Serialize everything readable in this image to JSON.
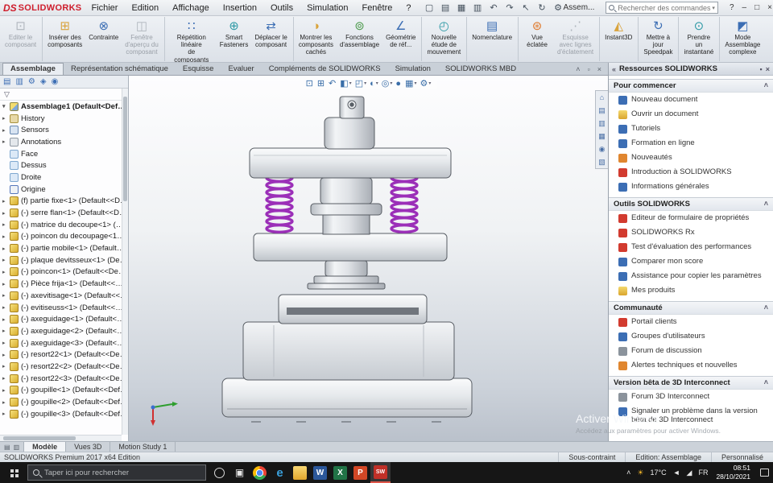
{
  "colors": {
    "logo_red": "#cf1e2c",
    "spring": "#9b2fb8",
    "accent_blue": "#3c6eb4"
  },
  "titlebar": {
    "logo_ds": "DS",
    "logo_text": "SOLIDWORKS",
    "menus": [
      "Fichier",
      "Edition",
      "Affichage",
      "Insertion",
      "Outils",
      "Simulation",
      "Fenêtre",
      "?"
    ],
    "qat": [
      {
        "g": "▢",
        "n": "new-document-icon"
      },
      {
        "g": "▤",
        "n": "open-document-icon"
      },
      {
        "g": "▦",
        "n": "save-icon"
      },
      {
        "g": "▥",
        "n": "print-icon"
      },
      {
        "g": "↶",
        "n": "undo-icon"
      },
      {
        "g": "↷",
        "n": "redo-icon"
      },
      {
        "g": "↖",
        "n": "select-icon"
      },
      {
        "g": "↻",
        "n": "rebuild-icon"
      },
      {
        "g": "⚙",
        "n": "options-icon"
      }
    ],
    "doc_name": "Assem...",
    "search_placeholder": "Rechercher des commandes",
    "search_drop": "▾",
    "win": [
      {
        "g": "?",
        "n": "help-button"
      },
      {
        "g": "–",
        "n": "minimize-button"
      },
      {
        "g": "□",
        "n": "maximize-button"
      },
      {
        "g": "×",
        "n": "close-button"
      }
    ]
  },
  "ribbon": {
    "buttons": [
      {
        "icon": "⊡",
        "ic": "ic-gr",
        "label": "Editer le\ncomposant",
        "cls": "disabled sep"
      },
      {
        "icon": "⊞",
        "ic": "ic-y",
        "label": "Insérer des\ncomposants"
      },
      {
        "icon": "⊗",
        "ic": "ic-b",
        "label": "Contrainte"
      },
      {
        "icon": "◫",
        "ic": "ic-gr",
        "label": "Fenêtre\nd'aperçu du\ncomposant",
        "cls": "disabled sep"
      },
      {
        "icon": "∷",
        "ic": "ic-b",
        "label": "Répétition linéaire\nde composants"
      },
      {
        "icon": "⊕",
        "ic": "ic-t",
        "label": "Smart\nFasteners"
      },
      {
        "icon": "⇄",
        "ic": "ic-b",
        "label": "Déplacer le\ncomposant",
        "cls": "sep"
      },
      {
        "icon": "◑",
        "ic": "ic-y",
        "label": "Montrer les\ncomposants\ncachés"
      },
      {
        "icon": "⊚",
        "ic": "ic-g",
        "label": "Fonctions\nd'assemblage"
      },
      {
        "icon": "∠",
        "ic": "ic-b",
        "label": "Géométrie\nde réf...",
        "cls": "sep"
      },
      {
        "icon": "◴",
        "ic": "ic-t",
        "label": "Nouvelle\nétude de\nmouvement",
        "cls": "sep"
      },
      {
        "icon": "▤",
        "ic": "ic-b",
        "label": "Nomenclature",
        "cls": "sep"
      },
      {
        "icon": "⊛",
        "ic": "ic-o",
        "label": "Vue\néclatée"
      },
      {
        "icon": "⋰",
        "ic": "ic-gr",
        "label": "Esquisse\navec lignes\nd'éclatement",
        "cls": "disabled sep"
      },
      {
        "icon": "◭",
        "ic": "ic-y",
        "label": "Instant3D",
        "cls": "sep"
      },
      {
        "icon": "↻",
        "ic": "ic-b",
        "label": "Mettre à\njour\nSpeedpak",
        "cls": "sep"
      },
      {
        "icon": "⊙",
        "ic": "ic-t",
        "label": "Prendre\nun\ninstantané",
        "cls": "sep"
      },
      {
        "icon": "◩",
        "ic": "ic-b",
        "label": "Mode\nAssemblage\ncomplexe"
      }
    ]
  },
  "tabs": {
    "items": [
      {
        "label": "Assemblage",
        "cls": "active"
      },
      {
        "label": "Représentation schématique"
      },
      {
        "label": "Esquisse"
      },
      {
        "label": "Evaluer"
      },
      {
        "label": "Compléments de SOLIDWORKS"
      },
      {
        "label": "Simulation"
      },
      {
        "label": "SOLIDWORKS MBD"
      }
    ],
    "right": [
      {
        "g": "˄",
        "n": "collapse-ribbon-icon"
      },
      {
        "g": "▫",
        "n": "restore-window-icon"
      },
      {
        "g": "×",
        "n": "close-document-icon"
      }
    ]
  },
  "tree": {
    "tabs": [
      {
        "g": "▤",
        "n": "feature-manager-tab"
      },
      {
        "g": "▥",
        "n": "property-manager-tab"
      },
      {
        "g": "⚙",
        "n": "configuration-manager-tab"
      },
      {
        "g": "◈",
        "n": "dimxpert-manager-tab"
      },
      {
        "g": "◉",
        "n": "display-manager-tab"
      }
    ],
    "more_glyph": "»",
    "filter_glyph": "▽",
    "root": "Assemblage1 (Default<Default_Display...",
    "items": [
      {
        "ic": "hist",
        "a": "show",
        "label": "History"
      },
      {
        "ic": "sens",
        "a": "show",
        "label": "Sensors"
      },
      {
        "ic": "ann",
        "a": "show",
        "label": "Annotations"
      },
      {
        "ic": "plane",
        "label": "Face"
      },
      {
        "ic": "plane",
        "label": "Dessus"
      },
      {
        "ic": "plane",
        "label": "Droite"
      },
      {
        "ic": "orig",
        "label": "Origine"
      },
      {
        "ic": "part",
        "a": "show",
        "label": "(f) partie fixe<1> (Default<<Defau..."
      },
      {
        "ic": "part",
        "a": "show",
        "label": "(-) serre flan<1> (Default<<Defaul"
      },
      {
        "ic": "part",
        "a": "show",
        "label": "(-) matrice du decoupe<1> (Defaul..."
      },
      {
        "ic": "part",
        "a": "show",
        "label": "(-) poincon du decoupage<1> (De..."
      },
      {
        "ic": "part",
        "a": "show",
        "label": "(-) partie mobile<1> (Default<<D..."
      },
      {
        "ic": "part",
        "a": "show",
        "label": "(-) plaque devitsseux<1> (Default<..."
      },
      {
        "ic": "part",
        "a": "show",
        "label": "(-) poincon<1> (Default<<Default..."
      },
      {
        "ic": "part",
        "a": "show",
        "label": "(-) Pièce frija<1> (Default<<Defau..."
      },
      {
        "ic": "part",
        "a": "show",
        "label": "(-) axevitisage<1> (Default<<Defa..."
      },
      {
        "ic": "part",
        "a": "show",
        "label": "(-) evitiseuss<1> (Default<<Defaul..."
      },
      {
        "ic": "part",
        "a": "show",
        "label": "(-) axeguidage<1> (Default<<Defa..."
      },
      {
        "ic": "part",
        "a": "show",
        "label": "(-) axeguidage<2> (Default<<Defa..."
      },
      {
        "ic": "part",
        "a": "show",
        "label": "(-) axeguidage<3> (Default<<Defa..."
      },
      {
        "ic": "part",
        "a": "show",
        "label": "(-) resort22<1> (Default<<Default..."
      },
      {
        "ic": "part",
        "a": "show",
        "label": "(-) resort22<2> (Default<<Default..."
      },
      {
        "ic": "part",
        "a": "show",
        "label": "(-) resort22<3> (Default<<Default..."
      },
      {
        "ic": "part",
        "a": "show",
        "label": "(-) goupille<1> (Default<<Default..."
      },
      {
        "ic": "part",
        "a": "show",
        "label": "(-) goupille<2> (Default<<Default..."
      },
      {
        "ic": "part",
        "a": "show",
        "label": "(-) goupille<3> (Default<<Default..."
      }
    ]
  },
  "viewport": {
    "toolbar": [
      {
        "g": "⊡",
        "n": "zoom-to-fit-icon"
      },
      {
        "g": "⊞",
        "n": "zoom-to-area-icon"
      },
      {
        "g": "↶",
        "n": "previous-view-icon"
      },
      {
        "g": "◧",
        "n": "section-view-icon",
        "d": "▾"
      },
      {
        "g": "◰",
        "n": "view-orientation-icon",
        "d": "▾"
      },
      {
        "g": "◐",
        "n": "display-style-icon",
        "d": "▾"
      },
      {
        "g": "◎",
        "n": "hide-show-items-icon",
        "d": "▾"
      },
      {
        "g": "●",
        "n": "edit-appearance-icon"
      },
      {
        "g": "▦",
        "n": "apply-scene-icon",
        "d": "▾"
      },
      {
        "g": "⚙",
        "n": "view-settings-icon",
        "d": "▾"
      }
    ]
  },
  "paneicons": [
    {
      "g": "⌂",
      "n": "solidworks-resources-tab"
    },
    {
      "g": "▤",
      "n": "design-library-tab"
    },
    {
      "g": "▥",
      "n": "file-explorer-tab"
    },
    {
      "g": "▦",
      "n": "view-palette-tab"
    },
    {
      "g": "◉",
      "n": "appearances-tab"
    },
    {
      "g": "▧",
      "n": "custom-properties-tab"
    }
  ],
  "taskpane": {
    "back_glyph": "«",
    "pin_glyph": "▪",
    "close_glyph": "×",
    "title": "Ressources SOLIDWORKS",
    "rows": [
      {
        "t": "hdr",
        "label": "Pour commencer"
      },
      {
        "t": "it",
        "ic": "b",
        "n": "new-document-icon",
        "label": "Nouveau document"
      },
      {
        "t": "it",
        "ic": "y",
        "n": "open-document-icon",
        "label": "Ouvrir un document"
      },
      {
        "t": "it",
        "ic": "b",
        "n": "tutorials-icon",
        "label": "Tutoriels"
      },
      {
        "t": "it",
        "ic": "b",
        "n": "online-training-icon",
        "label": "Formation en ligne"
      },
      {
        "t": "it",
        "ic": "o",
        "n": "whats-new-icon",
        "label": "Nouveautés"
      },
      {
        "t": "it",
        "ic": "r",
        "n": "introduction-icon",
        "label": "Introduction à SOLIDWORKS"
      },
      {
        "t": "it",
        "ic": "b",
        "n": "general-info-icon",
        "label": "Informations générales"
      },
      {
        "t": "hdr",
        "label": "Outils SOLIDWORKS"
      },
      {
        "t": "it",
        "ic": "r",
        "n": "property-tab-builder-icon",
        "label": "Editeur de formulaire de propriétés"
      },
      {
        "t": "it",
        "ic": "r",
        "n": "solidworks-rx-icon",
        "label": "SOLIDWORKS Rx"
      },
      {
        "t": "it",
        "ic": "r",
        "n": "performance-benchmark-icon",
        "label": "Test d'évaluation des performances"
      },
      {
        "t": "it",
        "ic": "b",
        "n": "compare-score-icon",
        "label": "Comparer mon score"
      },
      {
        "t": "it",
        "ic": "b",
        "n": "copy-settings-icon",
        "label": "Assistance pour copier les paramètres"
      },
      {
        "t": "it",
        "ic": "y",
        "n": "my-products-icon",
        "label": "Mes produits"
      },
      {
        "t": "hdr",
        "label": "Communauté"
      },
      {
        "t": "it",
        "ic": "r",
        "n": "customer-portal-icon",
        "label": "Portail clients"
      },
      {
        "t": "it",
        "ic": "b",
        "n": "user-groups-icon",
        "label": "Groupes d'utilisateurs"
      },
      {
        "t": "it",
        "ic": "gr",
        "n": "discussion-forum-icon",
        "label": "Forum de discussion"
      },
      {
        "t": "it",
        "ic": "o",
        "n": "technical-alerts-icon",
        "label": "Alertes techniques et nouvelles"
      },
      {
        "t": "hdr",
        "label": "Version bêta de 3D Interconnect"
      },
      {
        "t": "it",
        "ic": "gr",
        "n": "interconnect-forum-icon",
        "label": "Forum 3D Interconnect"
      },
      {
        "t": "it",
        "ic": "b",
        "n": "report-problem-icon",
        "label": "Signaler un problème dans la version bêta de 3D Interconnect"
      }
    ]
  },
  "watermark": {
    "line1": "Activer Windows",
    "line2": "Accédez aux paramètres pour activer Windows."
  },
  "doctabs": {
    "icons": [
      {
        "g": "▤",
        "n": "model-tabs-menu-icon"
      },
      {
        "g": "▥",
        "n": "model-tabs-list-icon"
      }
    ],
    "items": [
      {
        "label": "Modèle",
        "cls": "active"
      },
      {
        "label": "Vues 3D"
      },
      {
        "label": "Motion Study 1"
      }
    ]
  },
  "statusbar": {
    "left": "SOLIDWORKS Premium 2017 x64 Edition",
    "status": "Sous-contraint",
    "mode": "Edition: Assemblage",
    "custom": "Personnalisé"
  },
  "taskbar": {
    "search_placeholder": "Taper ici pour rechercher",
    "icons": [
      {
        "c": "cortana",
        "g": "",
        "n": "cortana-icon"
      },
      {
        "c": "tview",
        "g": "▣",
        "n": "task-view-icon"
      },
      {
        "c": "chrome",
        "g": "",
        "n": "chrome-icon"
      },
      {
        "c": "edge",
        "g": "e",
        "n": "edge-icon"
      },
      {
        "c": "explorer",
        "g": "",
        "n": "file-explorer-icon"
      },
      {
        "c": "word",
        "g": "W",
        "n": "word-icon"
      },
      {
        "c": "excel",
        "g": "X",
        "n": "excel-icon"
      },
      {
        "c": "ppt",
        "g": "P",
        "n": "powerpoint-icon"
      },
      {
        "c": "sw",
        "g": "SW",
        "n": "solidworks-taskbar-icon"
      }
    ],
    "tray": [
      {
        "g": "˄",
        "n": "hidden-icons-chevron-icon"
      },
      {
        "g": "☀",
        "c": "sun",
        "n": "weather-icon"
      },
      {
        "g": "17°C",
        "n": "temperature-text"
      },
      {
        "g": "◄",
        "n": "speaker-icon"
      },
      {
        "g": "◢",
        "n": "network-icon"
      },
      {
        "g": "FR",
        "n": "language-indicator"
      }
    ],
    "clock": {
      "time": "08:51",
      "date": "28/10/2021"
    }
  }
}
